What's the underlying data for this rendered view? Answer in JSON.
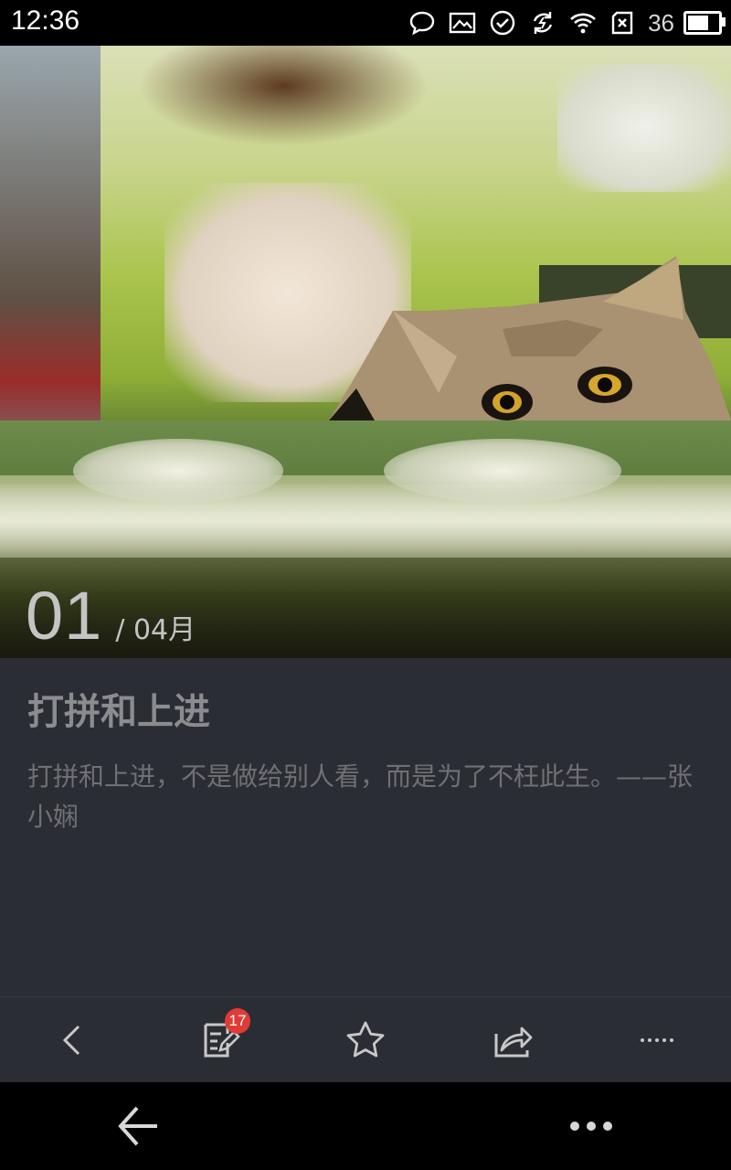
{
  "status_bar": {
    "time": "12:36",
    "battery_level": "36",
    "icons": [
      "chat-bubble-icon",
      "image-icon",
      "check-circle-icon",
      "sync-icon",
      "wifi-icon",
      "sim-disabled-icon",
      "battery-icon"
    ]
  },
  "hero": {
    "image": "cat-peeking-over-table-photo",
    "day": "01",
    "month": "/ 04月"
  },
  "article": {
    "title": "打拼和上进",
    "body": "打拼和上进，不是做给别人看，而是为了不枉此生。——张小娴"
  },
  "toolbar": {
    "items": [
      {
        "icon": "chevron-left-icon"
      },
      {
        "icon": "edit-note-icon",
        "badge": "17"
      },
      {
        "icon": "star-icon"
      },
      {
        "icon": "share-icon"
      },
      {
        "icon": "more-dots-icon"
      }
    ]
  },
  "nav_bar": {
    "items": [
      {
        "icon": "back-arrow-icon"
      },
      {
        "icon": "more-dots-icon"
      }
    ]
  },
  "colors": {
    "content_bg": "#2b2d34",
    "badge": "#e23a35",
    "title_text": "#8b8c90",
    "body_text": "#6e7075"
  }
}
